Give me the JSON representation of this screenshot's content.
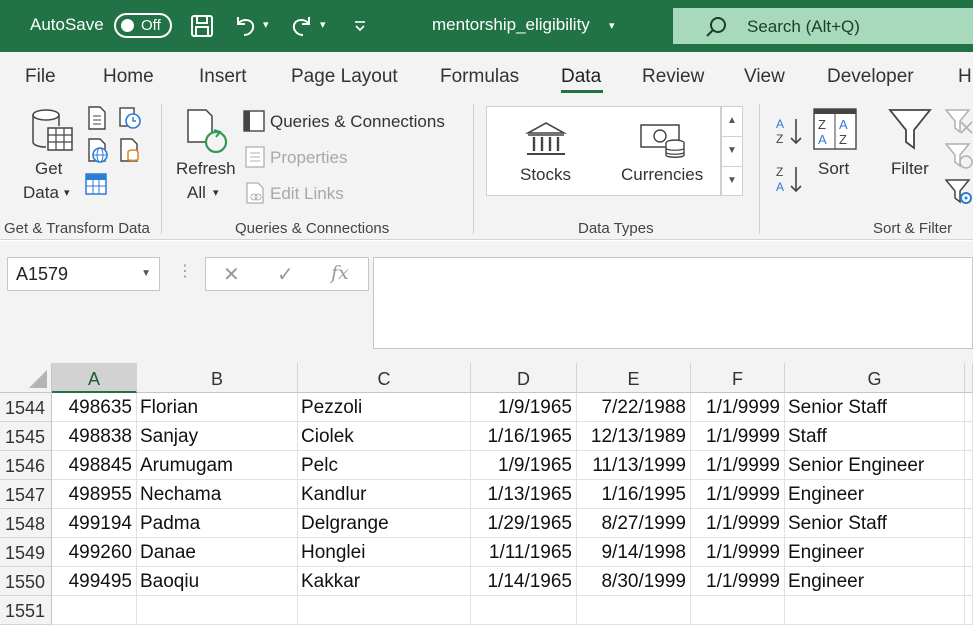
{
  "titlebar": {
    "autosave_label": "AutoSave",
    "autosave_state": "Off",
    "filename": "mentorship_eligibility",
    "search_placeholder": "Search (Alt+Q)"
  },
  "tabs": [
    "File",
    "Home",
    "Insert",
    "Page Layout",
    "Formulas",
    "Data",
    "Review",
    "View",
    "Developer",
    "H"
  ],
  "active_tab": "Data",
  "ribbon": {
    "get_data_line1": "Get",
    "get_data_line2": "Data",
    "group_get_transform": "Get & Transform Data",
    "refresh_line1": "Refresh",
    "refresh_line2": "All",
    "queries_connections": "Queries & Connections",
    "properties": "Properties",
    "edit_links": "Edit Links",
    "group_queries": "Queries & Connections",
    "stocks": "Stocks",
    "currencies": "Currencies",
    "group_data_types": "Data Types",
    "sort": "Sort",
    "filter": "Filter",
    "group_sort_filter": "Sort & Filter"
  },
  "formula_bar": {
    "name_box": "A1579",
    "fx": "fx",
    "value": ""
  },
  "grid": {
    "columns": [
      "A",
      "B",
      "C",
      "D",
      "E",
      "F",
      "G"
    ],
    "selected_column": "A",
    "rows": [
      {
        "num": "1544",
        "cells": [
          "498635",
          "Florian",
          "Pezzoli",
          "1/9/1965",
          "7/22/1988",
          "1/1/9999",
          "Senior Staff"
        ]
      },
      {
        "num": "1545",
        "cells": [
          "498838",
          "Sanjay",
          "Ciolek",
          "1/16/1965",
          "12/13/1989",
          "1/1/9999",
          "Staff"
        ]
      },
      {
        "num": "1546",
        "cells": [
          "498845",
          "Arumugam",
          "Pelc",
          "1/9/1965",
          "11/13/1999",
          "1/1/9999",
          "Senior Engineer"
        ]
      },
      {
        "num": "1547",
        "cells": [
          "498955",
          "Nechama",
          "Kandlur",
          "1/13/1965",
          "1/16/1995",
          "1/1/9999",
          "Engineer"
        ]
      },
      {
        "num": "1548",
        "cells": [
          "499194",
          "Padma",
          "Delgrange",
          "1/29/1965",
          "8/27/1999",
          "1/1/9999",
          "Senior Staff"
        ]
      },
      {
        "num": "1549",
        "cells": [
          "499260",
          "Danae",
          "Honglei",
          "1/11/1965",
          "9/14/1998",
          "1/1/9999",
          "Engineer"
        ]
      },
      {
        "num": "1550",
        "cells": [
          "499495",
          "Baoqiu",
          "Kakkar",
          "1/14/1965",
          "8/30/1999",
          "1/1/9999",
          "Engineer"
        ]
      },
      {
        "num": "1551",
        "cells": [
          "",
          "",
          "",
          "",
          "",
          "",
          ""
        ]
      }
    ]
  }
}
